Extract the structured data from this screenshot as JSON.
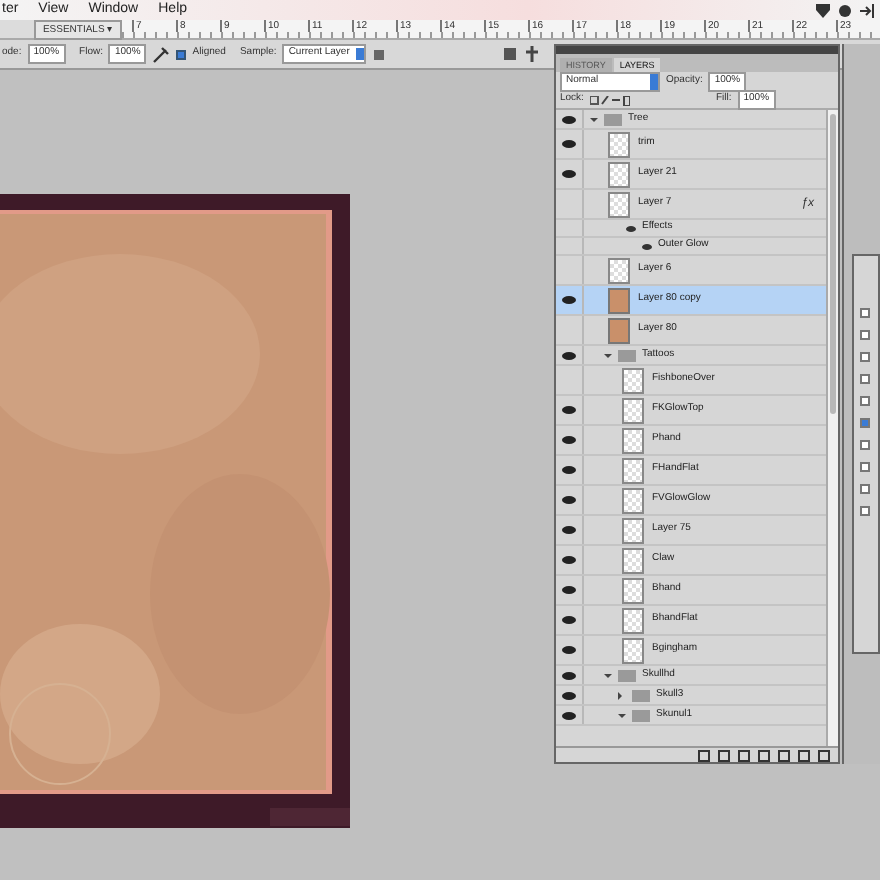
{
  "menu": [
    "ter",
    "View",
    "Window",
    "Help"
  ],
  "workspace": "ESSENTIALS ▾",
  "ruler": [
    "7",
    "8",
    "9",
    "10",
    "11",
    "12",
    "13",
    "14",
    "15",
    "16",
    "17",
    "18",
    "19",
    "20",
    "21",
    "22",
    "23"
  ],
  "options": {
    "mode_label": "ode:",
    "mode_value": "100%",
    "flow_label": "Flow:",
    "flow_value": "100%",
    "aligned": {
      "label": "Aligned",
      "checked": true
    },
    "sample_label": "Sample:",
    "sample_value": "Current Layer"
  },
  "layers_panel": {
    "tabs": [
      {
        "label": "HISTORY",
        "selected": false
      },
      {
        "label": "LAYERS",
        "selected": true
      }
    ],
    "blend": "Normal",
    "opacity_label": "Opacity:",
    "opacity": "100%",
    "lock_label": "Lock:",
    "fill_label": "Fill:",
    "fill": "100%",
    "layers": [
      {
        "kind": "group",
        "name": "Tree",
        "visible": true,
        "expanded": true,
        "children": [
          {
            "kind": "layer",
            "name": "trim",
            "visible": true,
            "selected": false
          },
          {
            "kind": "layer",
            "name": "Layer 21",
            "visible": true,
            "selected": false
          },
          {
            "kind": "layer",
            "name": "Layer 7",
            "visible": false,
            "selected": false,
            "fx": "ƒx",
            "children": [
              {
                "kind": "effects",
                "name": "Effects"
              },
              {
                "kind": "effect",
                "name": "Outer Glow"
              }
            ]
          },
          {
            "kind": "layer",
            "name": "Layer 6",
            "visible": false,
            "selected": false
          },
          {
            "kind": "texture",
            "name": "Layer 80 copy",
            "visible": true,
            "selected": true
          },
          {
            "kind": "texture",
            "name": "Layer 80",
            "visible": false,
            "selected": false
          },
          {
            "kind": "group",
            "name": "Tattoos",
            "visible": true,
            "expanded": true,
            "children": [
              {
                "kind": "layer",
                "name": "FishboneOver",
                "visible": false,
                "selected": false
              },
              {
                "kind": "layer",
                "name": "FKGlowTop",
                "visible": true,
                "selected": false
              },
              {
                "kind": "layer",
                "name": "Phand",
                "visible": true,
                "selected": false
              },
              {
                "kind": "layer",
                "name": "FHandFlat",
                "visible": true,
                "selected": false
              },
              {
                "kind": "layer",
                "name": "FVGlowGlow",
                "visible": true,
                "selected": false
              },
              {
                "kind": "layer",
                "name": "Layer 75",
                "visible": true,
                "selected": false
              },
              {
                "kind": "layer",
                "name": "Claw",
                "visible": true,
                "selected": false
              },
              {
                "kind": "layer",
                "name": "Bhand",
                "visible": true,
                "selected": false
              },
              {
                "kind": "layer",
                "name": "BhandFlat",
                "visible": true,
                "selected": false
              },
              {
                "kind": "layer",
                "name": "Bgingham",
                "visible": true,
                "selected": false
              }
            ]
          },
          {
            "kind": "group",
            "name": "Skullhd",
            "visible": true,
            "expanded": true,
            "children": [
              {
                "kind": "group",
                "name": "Skull3",
                "visible": true,
                "expanded": false
              },
              {
                "kind": "group",
                "name": "Skunul1",
                "visible": true,
                "expanded": true
              }
            ]
          }
        ]
      }
    ]
  },
  "side_panel": {
    "options": [
      {
        "checked": false
      },
      {
        "checked": false
      },
      {
        "checked": false
      },
      {
        "checked": false
      },
      {
        "checked": false
      },
      {
        "checked": true
      },
      {
        "checked": false
      },
      {
        "checked": false
      },
      {
        "checked": false
      },
      {
        "checked": false
      }
    ]
  }
}
